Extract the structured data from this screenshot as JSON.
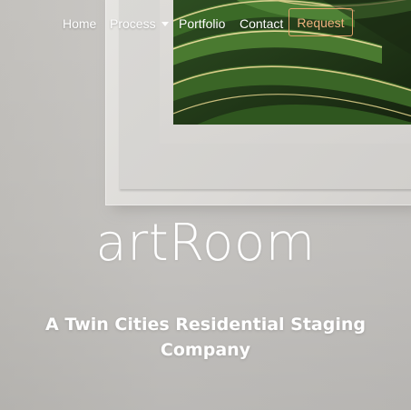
{
  "nav": {
    "links": [
      {
        "label": "Home"
      },
      {
        "label": "Process"
      },
      {
        "label": "Portfolio"
      },
      {
        "label": "Contact"
      }
    ],
    "request_label": "Request"
  },
  "hero": {
    "title": "artRoom",
    "tagline": "A Twin Cities Residential Staging Company"
  },
  "colors": {
    "request_accent": "#e3a36b",
    "text": "#ffffff",
    "wall": "#c9c7c4",
    "leaf_green": "#3f6b2a"
  }
}
